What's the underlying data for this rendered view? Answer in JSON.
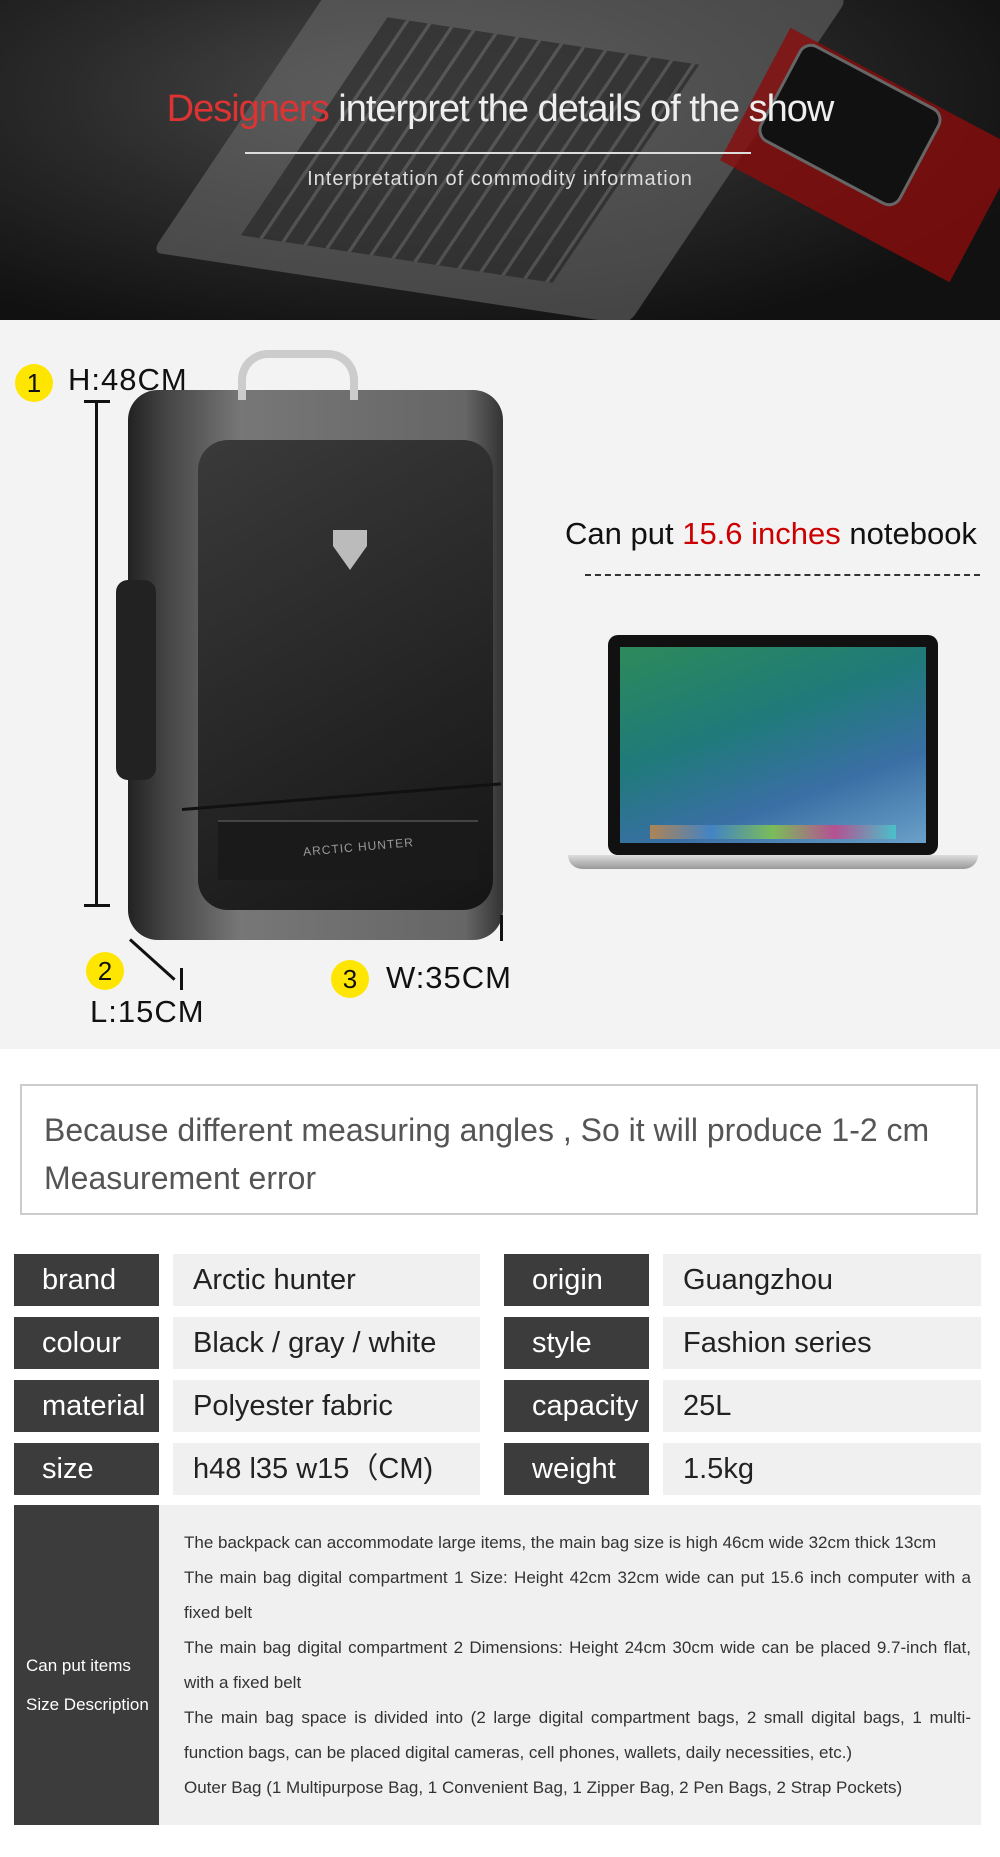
{
  "hero": {
    "title_red": "Designers",
    "title_rest": " interpret the details of the show",
    "subtitle": "Interpretation of commodity information"
  },
  "product": {
    "height": {
      "num": "1",
      "label": "H:48CM"
    },
    "length": {
      "num": "2",
      "label": "L:15CM"
    },
    "width": {
      "num": "3",
      "label": "W:35CM"
    },
    "bag_brand": "ARCTIC HUNTER",
    "capacity_pre": "Can put ",
    "capacity_red": "15.6 inches",
    "capacity_post": " notebook",
    "accent_color": "#cc0000",
    "badge_color": "#ffe600"
  },
  "note": "Because different measuring angles , So it will produce 1-2 cm Measurement error",
  "specs": [
    {
      "key": "brand",
      "value": "Arctic hunter"
    },
    {
      "key": "origin",
      "value": "Guangzhou"
    },
    {
      "key": "colour",
      "value": "Black / gray / white"
    },
    {
      "key": "style",
      "value": "Fashion series"
    },
    {
      "key": "material",
      "value": "Polyester fabric"
    },
    {
      "key": "capacity",
      "value": "25L"
    },
    {
      "key": "size",
      "value": "h48 l35 w15（CM)"
    },
    {
      "key": "weight",
      "value": "1.5kg"
    }
  ],
  "description": {
    "label_1": "Can put items",
    "label_2": "Size Description",
    "lines": [
      "The backpack can accommodate large items, the main bag size is high 46cm wide 32cm thick 13cm",
      "The main bag digital compartment 1 Size: Height 42cm 32cm wide can put 15.6 inch computer with a fixed belt",
      "The main bag digital compartment 2 Dimensions: Height 24cm 30cm wide can be placed 9.7-inch flat, with a fixed belt",
      "The main bag space is divided into (2 large digital compartment bags, 2 small digital bags, 1 multi-function bags, can be placed digital cameras, cell phones, wallets, daily necessities, etc.)",
      "Outer Bag (1 Multipurpose Bag, 1 Convenient Bag, 1 Zipper Bag, 2 Pen Bags, 2 Strap Pockets)"
    ]
  }
}
